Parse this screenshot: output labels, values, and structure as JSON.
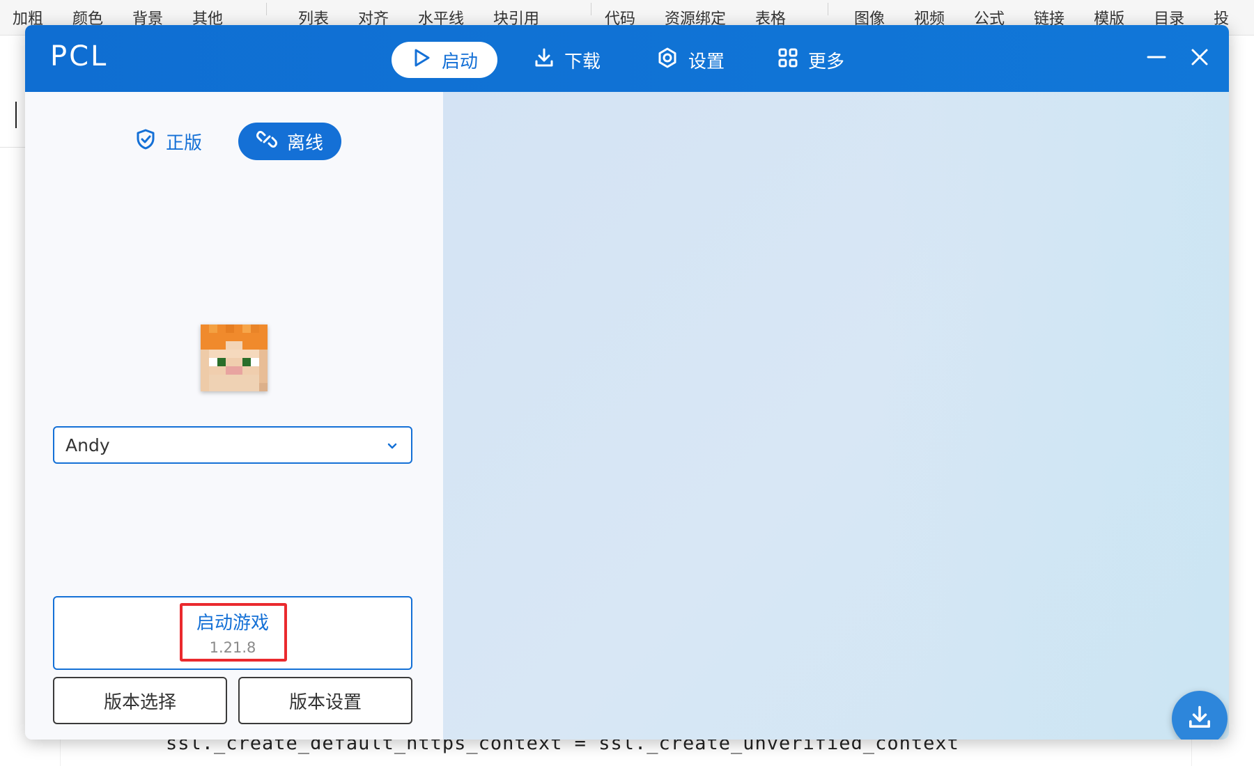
{
  "background_app": {
    "toolbar": {
      "group1": [
        "加粗",
        "颜色",
        "背景",
        "其他"
      ],
      "group2": [
        "列表",
        "对齐",
        "水平线",
        "块引用"
      ],
      "group3": [
        "代码",
        "资源绑定",
        "表格"
      ],
      "group4": [
        "图像",
        "视频",
        "公式",
        "链接",
        "模版",
        "目录",
        "投"
      ]
    },
    "code_line": "ssl._create_default_https_context = ssl._create_unverified_context"
  },
  "launcher": {
    "logo": "PCL",
    "nav": {
      "launch": "启动",
      "download": "下载",
      "settings": "设置",
      "more": "更多"
    },
    "account_tabs": {
      "official": "正版",
      "offline": "离线"
    },
    "username": "Andy",
    "launch_button": {
      "title": "启动游戏",
      "version": "1.21.8"
    },
    "version_select_label": "版本选择",
    "version_settings_label": "版本设置",
    "colors": {
      "accent": "#1470d6",
      "titlebar": "#1170d5",
      "highlight": "#ea2a2e"
    }
  }
}
